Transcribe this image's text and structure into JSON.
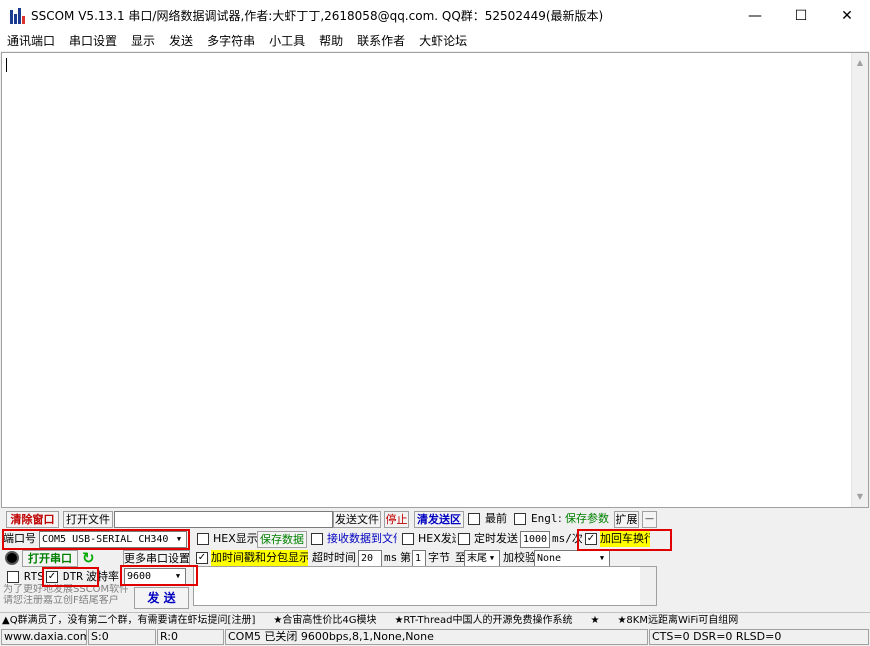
{
  "window": {
    "title": "SSCOM V5.13.1 串口/网络数据调试器,作者:大虾丁丁,2618058@qq.com. QQ群：52502449(最新版本)",
    "minimize": "—",
    "maximize": "☐",
    "close": "✕"
  },
  "menu": [
    "通讯端口",
    "串口设置",
    "显示",
    "发送",
    "多字符串",
    "小工具",
    "帮助",
    "联系作者",
    "大虾论坛"
  ],
  "row1": {
    "clear_window": "清除窗口",
    "open_file": "打开文件",
    "file_path": "",
    "send_file": "发送文件",
    "stop": "停止",
    "clear_send": "清发送区",
    "latest": "最前",
    "english": "Engl",
    "save_params": "保存参数",
    "expand": "扩展",
    "minus": "—"
  },
  "row2": {
    "port_label": "端口号",
    "port_value": "COM5 USB-SERIAL CH340",
    "hex_display": "HEX显示",
    "save_data": "保存数据",
    "recv_to_file": "接收数据到文件",
    "hex_send": "HEX发送",
    "timed_send": "定时发送",
    "interval": "1000",
    "interval_unit": "ms/次",
    "append_newline": "加回车换行"
  },
  "row3": {
    "open_port": "打开串口",
    "more_settings": "更多串口设置",
    "timestamp": "加时间戳和分包显示",
    "timeout_label": "超时时间",
    "timeout_value": "20",
    "timeout_unit": "ms",
    "nth": "第",
    "byte_index": "1",
    "byte_label": "字节",
    "to": "至",
    "end_value": "末尾",
    "checksum_label": "加校验",
    "checksum_value": "None"
  },
  "row4": {
    "rts": "RTS",
    "dtr": "DTR",
    "baud_label": "波特率",
    "baud_value": "9600"
  },
  "promo": {
    "line1": "为了更好地发展SSCOM软件",
    "line2": "请您注册嘉立创F结尾客户"
  },
  "send_button": "发 送",
  "adbar": [
    "▲Q群满员了，没有第二个群，有需要请在虾坛提问[注册]",
    "★合宙高性价比4G模块",
    "★RT-Thread中国人的开源免费操作系统",
    "★",
    "★8KM远距离WiFi可自组网"
  ],
  "status": {
    "site": "www.daxia.com",
    "sent": "S:0",
    "received": "R:0",
    "port_state": "COM5 已关闭  9600bps,8,1,None,None",
    "lines": "CTS=0 DSR=0 RLSD=0"
  }
}
